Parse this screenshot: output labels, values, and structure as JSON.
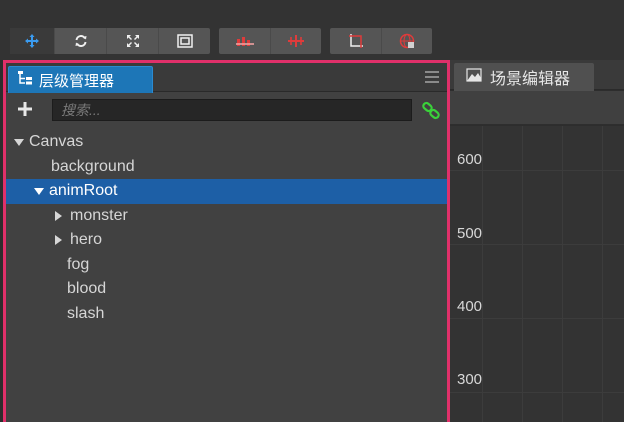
{
  "toolbar": {
    "groups": [
      {
        "tools": [
          "move-icon",
          "rotate-icon",
          "scale-icon",
          "rect-icon"
        ]
      },
      {
        "tools": [
          "local-pivot-icon",
          "global-pivot-icon"
        ]
      },
      {
        "tools": [
          "snap-icon",
          "globe-icon"
        ]
      }
    ]
  },
  "hierarchy": {
    "tab_label": "层级管理器",
    "search_placeholder": "搜索...",
    "nodes": [
      {
        "label": "Canvas",
        "arrow": "down"
      },
      {
        "label": "background"
      },
      {
        "label": "animRoot",
        "arrow": "down",
        "selected": true
      },
      {
        "label": "monster",
        "arrow": "right"
      },
      {
        "label": "hero",
        "arrow": "right"
      },
      {
        "label": "fog"
      },
      {
        "label": "blood"
      },
      {
        "label": "slash"
      }
    ]
  },
  "scene": {
    "tab_label": "场景编辑器",
    "ruler_labels": [
      "600",
      "500",
      "400",
      "300"
    ]
  },
  "colors": {
    "accent_border": "#e0306a",
    "tab_active": "#1d76b7",
    "selection": "#1d5fa6",
    "link_icon": "#3ad23a"
  }
}
